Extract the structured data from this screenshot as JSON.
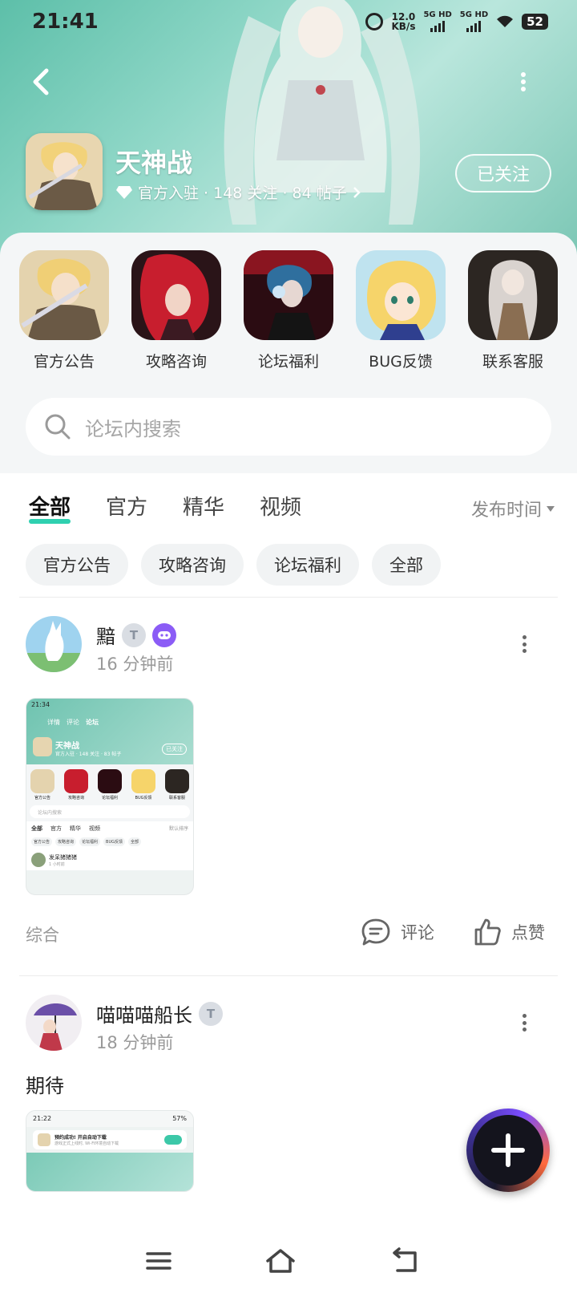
{
  "status_bar": {
    "time": "21:41",
    "speed_value": "12.0",
    "speed_unit": "KB/s",
    "signal1": "5G HD",
    "signal2": "5G HD",
    "battery": "52"
  },
  "header": {
    "game_name": "天神战",
    "meta": "官方入驻 · 148 关注 · 84 帖子",
    "follow_label": "已关注"
  },
  "shortcuts": [
    {
      "label": "官方公告",
      "icon": "official-notice-icon"
    },
    {
      "label": "攻略咨询",
      "icon": "guide-icon"
    },
    {
      "label": "论坛福利",
      "icon": "welfare-icon"
    },
    {
      "label": "BUG反馈",
      "icon": "bug-feedback-icon"
    },
    {
      "label": "联系客服",
      "icon": "customer-service-icon"
    }
  ],
  "search": {
    "placeholder": "论坛内搜索"
  },
  "tabs": [
    {
      "label": "全部",
      "active": true
    },
    {
      "label": "官方",
      "active": false
    },
    {
      "label": "精华",
      "active": false
    },
    {
      "label": "视频",
      "active": false
    }
  ],
  "sort": {
    "label": "发布时间"
  },
  "chips": [
    "官方公告",
    "攻略咨询",
    "论坛福利",
    "全部"
  ],
  "posts": [
    {
      "author": "黯",
      "time": "16 分钟前",
      "text": "",
      "category": "综合",
      "comment_label": "评论",
      "like_label": "点赞",
      "thumb": {
        "time": "21:34",
        "tabs": [
          "详情",
          "评论",
          "论坛"
        ],
        "game_name": "天神战",
        "meta": "官方入驻 · 148 关注 · 83 帖子",
        "follow": "已关注",
        "shortcuts": [
          "官方公告",
          "攻略咨询",
          "论坛福利",
          "BUG反馈",
          "联系客服"
        ],
        "search": "论坛内搜索",
        "tabs2": [
          "全部",
          "官方",
          "精华",
          "视频"
        ],
        "sort": "默认排序",
        "chips": [
          "官方公告",
          "攻略咨询",
          "论坛福利",
          "BUG反馈",
          "全部"
        ],
        "post_author": "发呆猪猪猪",
        "post_time": "1 小时前"
      }
    },
    {
      "author": "喵喵喵船长",
      "time": "18 分钟前",
      "text": "期待",
      "thumb": {
        "time": "21:22",
        "battery": "57%",
        "notice_title": "预约成功! 开启自动下载",
        "notice_sub": "游戏正式上线时, Wi-Fi环境自动下载"
      }
    }
  ],
  "colors": {
    "accent": "#2fd0b0",
    "hero": "#7cc7b5",
    "fab": "#7a4cff"
  }
}
